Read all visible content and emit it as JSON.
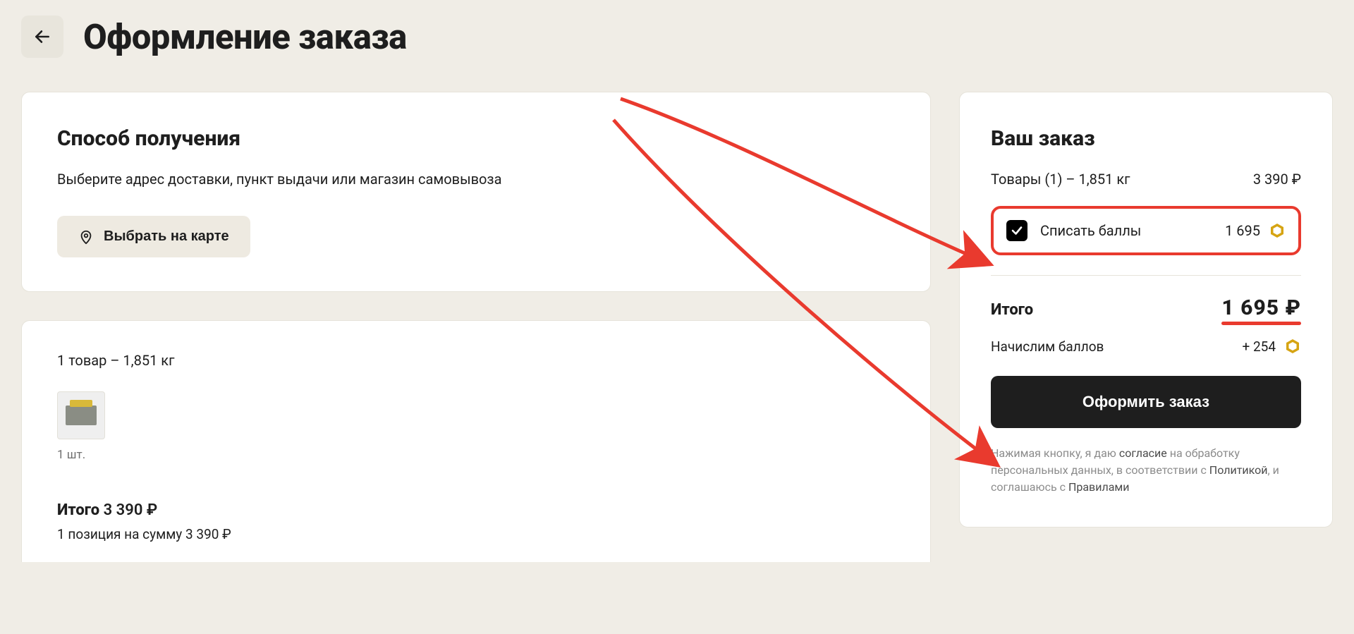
{
  "header": {
    "title": "Оформление заказа"
  },
  "delivery": {
    "title": "Способ получения",
    "subtitle": "Выберите адрес доставки, пункт выдачи или магазин самовывоза",
    "map_button": "Выбрать на карте"
  },
  "items": {
    "meta": "1 товар – 1,851 кг",
    "qty": "1 шт.",
    "total_label": "Итого ",
    "total_value": "3 390 ₽",
    "positions": "1 позиция на сумму 3 390 ₽"
  },
  "order": {
    "title": "Ваш заказ",
    "goods_label": "Товары (1) – 1,851 кг",
    "goods_value": "3 390 ₽",
    "points_label": "Списать баллы",
    "points_value": "1 695",
    "total_label": "Итого",
    "total_value": "1 695 ₽",
    "bonus_label": "Начислим баллов",
    "bonus_value": "+ 254",
    "submit": "Оформить заказ",
    "legal_1": "Нажимая кнопку, я даю ",
    "legal_consent": "согласие",
    "legal_2": " на обработку персональных данных, в соответствии с ",
    "legal_policy": "Политикой",
    "legal_3": ", и соглашаюсь с ",
    "legal_rules": "Правилами"
  }
}
